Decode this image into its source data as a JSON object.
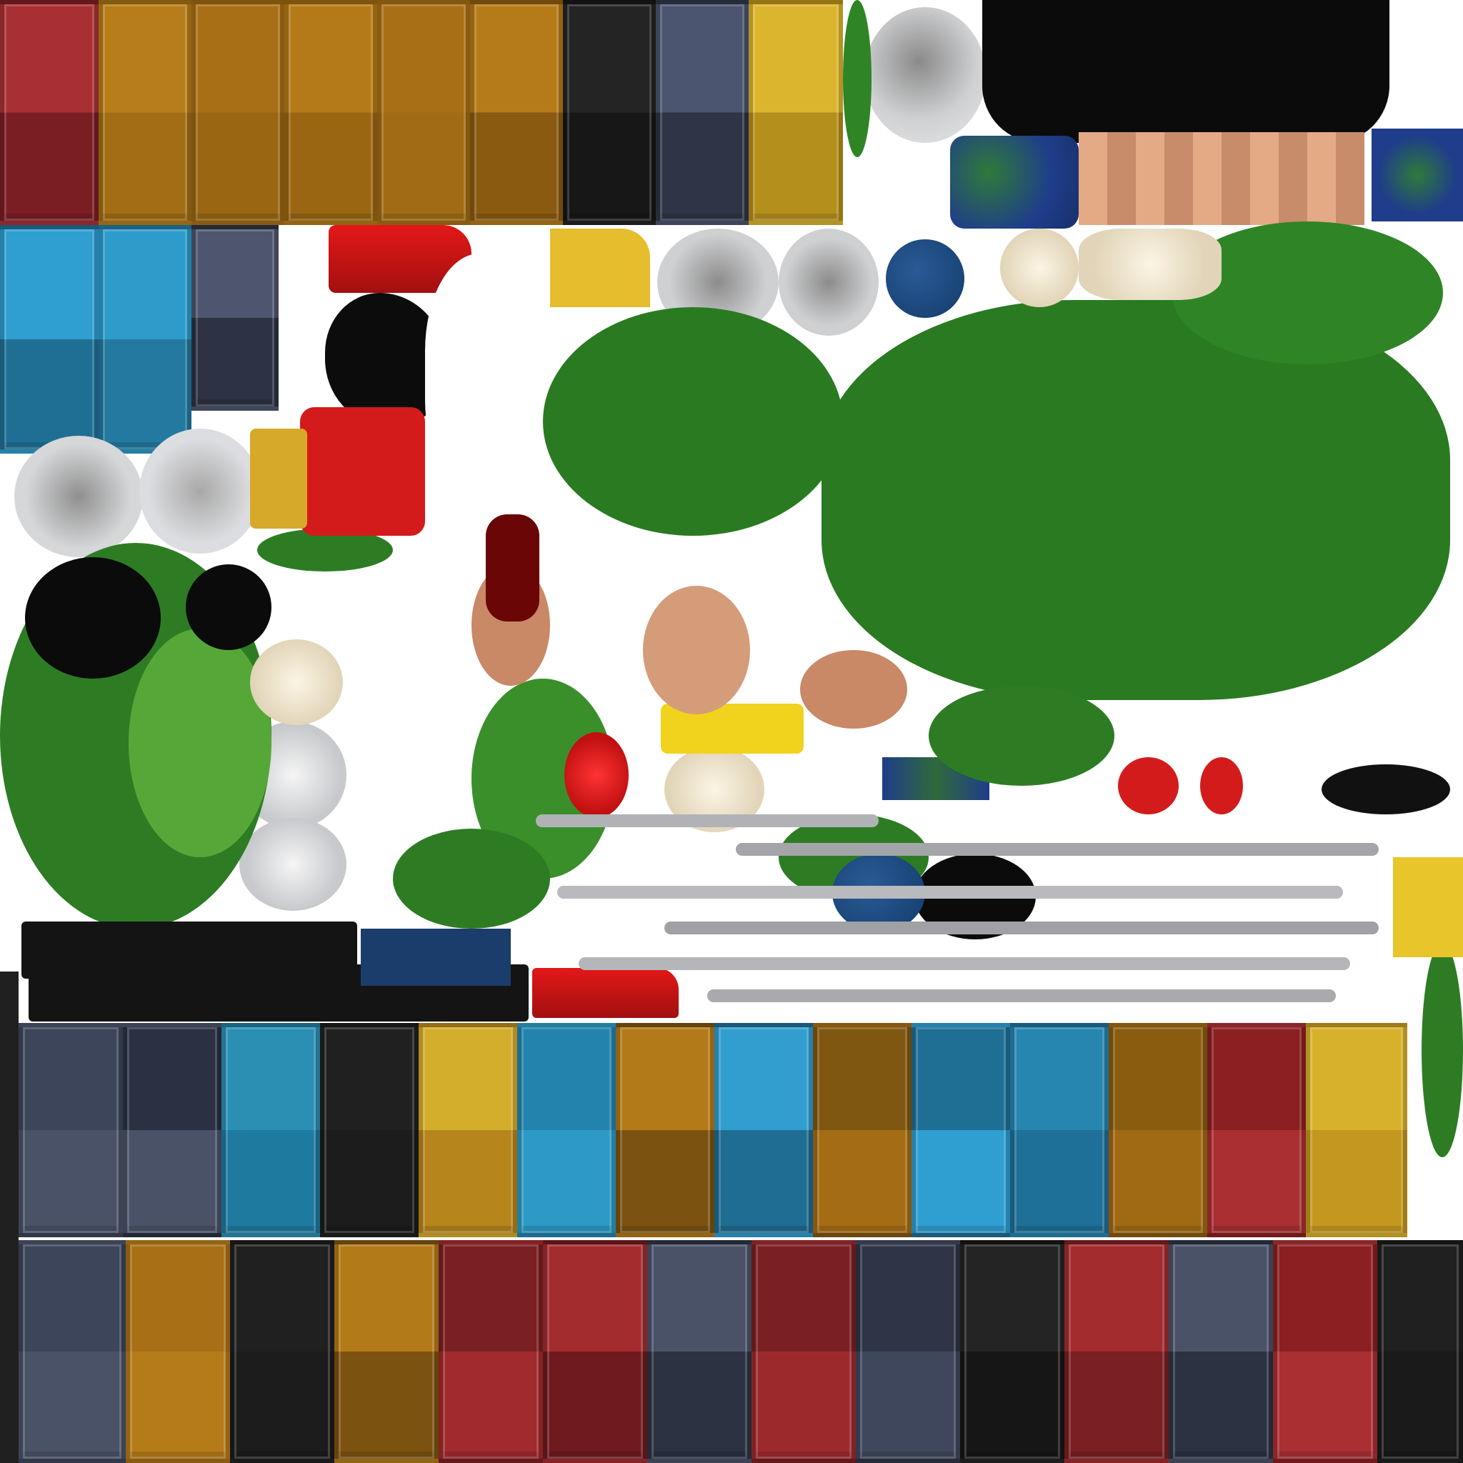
{
  "texture_atlas": {
    "palette": {
      "red": "#9b2a2c",
      "dark_red": "#7a1f22",
      "orange": "#b47a18",
      "dark_orange": "#7e5410",
      "yellow": "#d6b02c",
      "cyan": "#2f9dc8",
      "dark_cyan": "#1d6f8f",
      "slate": "#4a5268",
      "dark_slate": "#2c3242",
      "black": "#1c1c1c",
      "green": "#2c7a22",
      "light_green": "#5fae3a",
      "grey": "#b4b6ba",
      "cream": "#e9dcc4",
      "skin": "#d9a07a",
      "bright_red": "#d51b1b",
      "navy": "#173d6c",
      "globe_blue": "#1f3d8a"
    },
    "top_row_tiles": [
      "red",
      "orange",
      "orange",
      "orange",
      "orange",
      "orange",
      "black",
      "slate",
      "yellow"
    ],
    "left_column_tiles": [
      "cyan",
      "cyan",
      "slate"
    ],
    "bottom_row_a_tiles": [
      "slate",
      "dark_slate",
      "cyan",
      "black",
      "yellow",
      "cyan",
      "orange",
      "cyan",
      "dark_orange",
      "cyan",
      "cyan",
      "dark_orange",
      "red",
      "yellow"
    ],
    "bottom_row_b_tiles": [
      "slate",
      "orange",
      "black",
      "orange",
      "dark_red",
      "red",
      "slate",
      "dark_red",
      "dark_slate",
      "black",
      "red",
      "slate",
      "red",
      "black"
    ]
  }
}
